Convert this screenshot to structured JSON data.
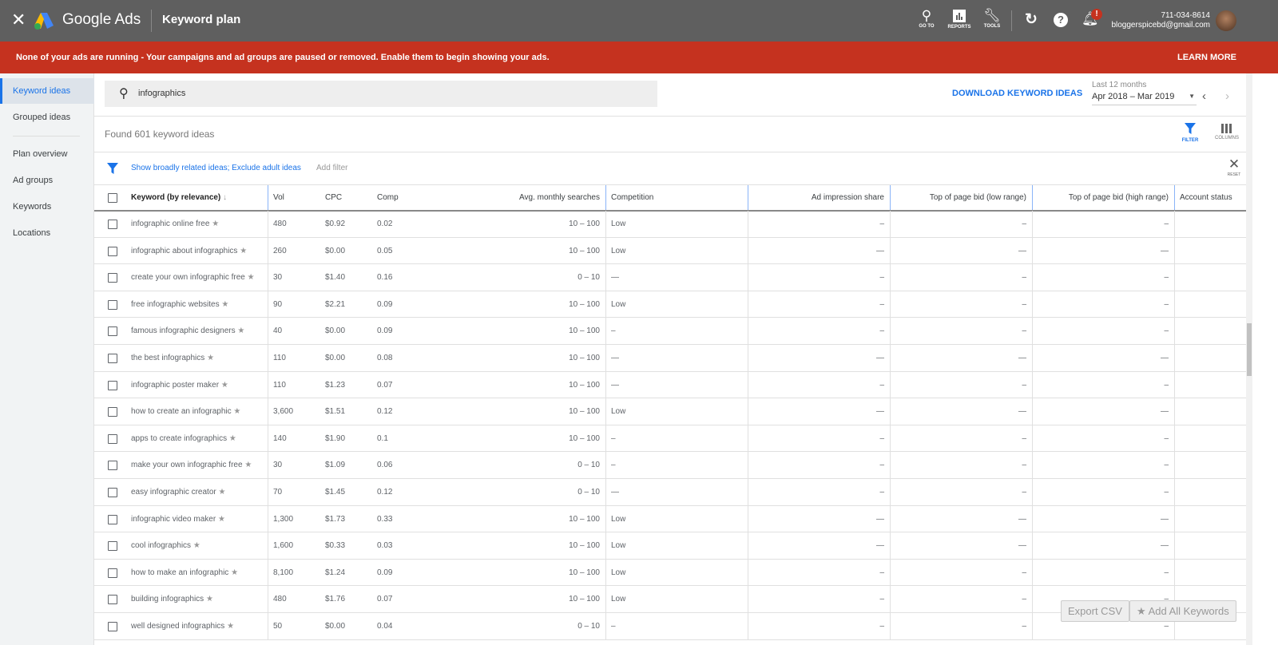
{
  "header": {
    "app_name": "Google Ads",
    "page_title": "Keyword plan",
    "goto_label": "GO TO",
    "reports_label": "REPORTS",
    "tools_label": "TOOLS",
    "notification_badge": "!",
    "account_id": "711-034-8614",
    "account_email": "bloggerspicebd@gmail.com"
  },
  "alert": {
    "bold": "None of your ads are running",
    "message": " - Your campaigns and ad groups are paused or removed. Enable them to begin showing your ads.",
    "action": "LEARN MORE"
  },
  "sidebar": {
    "items": [
      {
        "label": "Keyword ideas",
        "active": true
      },
      {
        "label": "Grouped ideas"
      },
      {
        "label": "Plan overview"
      },
      {
        "label": "Ad groups"
      },
      {
        "label": "Keywords"
      },
      {
        "label": "Locations"
      }
    ]
  },
  "search": {
    "value": "infographics"
  },
  "download_label": "DOWNLOAD KEYWORD IDEAS",
  "date_range": {
    "caption": "Last 12 months",
    "value": "Apr 2018 – Mar 2019"
  },
  "found_text": "Found 601 keyword ideas",
  "filter_label": "FILTER",
  "columns_label": "COLUMNS",
  "reset_label": "RESET",
  "filter_bar": {
    "active": "Show broadly related ideas; Exclude adult ideas",
    "add": "Add filter"
  },
  "table": {
    "headers": [
      "Keyword (by relevance)",
      "Vol",
      "CPC",
      "Comp",
      "Avg. monthly searches",
      "Competition",
      "Ad impression share",
      "Top of page bid (low range)",
      "Top of page bid (high range)",
      "Account status"
    ],
    "rows": [
      [
        "infographic online free",
        "480",
        "$0.92",
        "0.02",
        "10 – 100",
        "Low",
        "–",
        "–",
        "–",
        ""
      ],
      [
        "infographic about infographics",
        "260",
        "$0.00",
        "0.05",
        "10 – 100",
        "Low",
        "—",
        "—",
        "—",
        ""
      ],
      [
        "create your own infographic free",
        "30",
        "$1.40",
        "0.16",
        "0 – 10",
        "—",
        "–",
        "–",
        "–",
        ""
      ],
      [
        "free infographic websites",
        "90",
        "$2.21",
        "0.09",
        "10 – 100",
        "Low",
        "–",
        "–",
        "–",
        ""
      ],
      [
        "famous infographic designers",
        "40",
        "$0.00",
        "0.09",
        "10 – 100",
        "–",
        "–",
        "–",
        "–",
        ""
      ],
      [
        "the best infographics",
        "110",
        "$0.00",
        "0.08",
        "10 – 100",
        "—",
        "—",
        "—",
        "—",
        ""
      ],
      [
        "infographic poster maker",
        "110",
        "$1.23",
        "0.07",
        "10 – 100",
        "—",
        "–",
        "–",
        "–",
        ""
      ],
      [
        "how to create an infographic",
        "3,600",
        "$1.51",
        "0.12",
        "10 – 100",
        "Low",
        "—",
        "—",
        "—",
        ""
      ],
      [
        "apps to create infographics",
        "140",
        "$1.90",
        "0.1",
        "10 – 100",
        "–",
        "–",
        "–",
        "–",
        ""
      ],
      [
        "make your own infographic free",
        "30",
        "$1.09",
        "0.06",
        "0 – 10",
        "–",
        "–",
        "–",
        "–",
        ""
      ],
      [
        "easy infographic creator",
        "70",
        "$1.45",
        "0.12",
        "0 – 10",
        "—",
        "–",
        "–",
        "–",
        ""
      ],
      [
        "infographic video maker",
        "1,300",
        "$1.73",
        "0.33",
        "10 – 100",
        "Low",
        "—",
        "—",
        "—",
        ""
      ],
      [
        "cool infographics",
        "1,600",
        "$0.33",
        "0.03",
        "10 – 100",
        "Low",
        "—",
        "—",
        "—",
        ""
      ],
      [
        "how to make an infographic",
        "8,100",
        "$1.24",
        "0.09",
        "10 – 100",
        "Low",
        "–",
        "–",
        "–",
        ""
      ],
      [
        "building infographics",
        "480",
        "$1.76",
        "0.07",
        "10 – 100",
        "Low",
        "–",
        "–",
        "–",
        ""
      ],
      [
        "well designed infographics",
        "50",
        "$0.00",
        "0.04",
        "0 – 10",
        "–",
        "–",
        "–",
        "–",
        ""
      ]
    ]
  },
  "export_label": "Export CSV",
  "add_all_label": "Add All Keywords",
  "colors": {
    "topbar": "#5f5f5f",
    "alert": "#c5321f",
    "accent": "#1a73e8"
  }
}
